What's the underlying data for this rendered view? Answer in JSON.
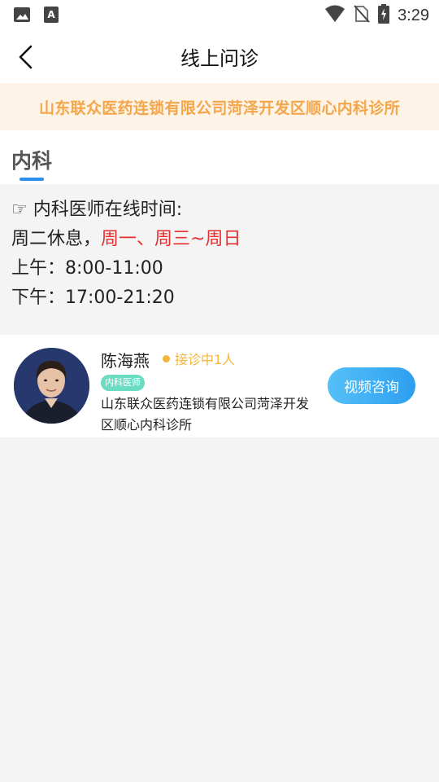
{
  "status_bar": {
    "time": "3:29",
    "left_icons": [
      "image-icon",
      "font-icon"
    ],
    "right_icons": [
      "wifi-icon",
      "no-sim-icon",
      "battery-charging-icon"
    ]
  },
  "header": {
    "title": "线上问诊",
    "back_icon": "chevron-left-icon"
  },
  "banner": {
    "text": "山东联众医药连锁有限公司菏泽开发区顺心内科诊所",
    "text_color": "#f4a64b",
    "background": "#fdf3e6"
  },
  "tabs": [
    {
      "label": "内科",
      "active": true
    }
  ],
  "accent_color": "#2f8ef0",
  "schedule": {
    "heading_icon": "☞",
    "heading": "内科医师在线时间:",
    "rest_prefix": "周二休息，",
    "rest_highlight": "周一、周三~周日",
    "morning": "上午：8:00-11:00",
    "afternoon": "下午：17:00-21:20"
  },
  "doctors": [
    {
      "name": "陈海燕",
      "status": "接诊中1人",
      "title": "内科医师",
      "org": "山东联众医药连锁有限公司菏泽开发区顺心内科诊所",
      "action_label": "视频咨询"
    }
  ]
}
